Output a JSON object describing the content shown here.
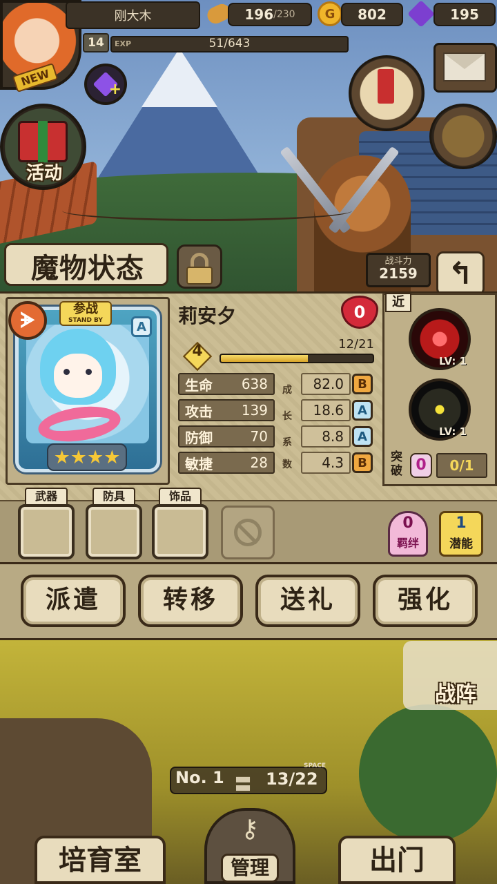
{
  "player": {
    "name": "刚大木",
    "level": "14",
    "exp_label": "EXP",
    "exp_value": "51/643",
    "exp_progress": 0.079,
    "new_tag": "NEW"
  },
  "resources": {
    "stamina": "196",
    "stamina_max": "/230",
    "gold": "802",
    "gems": "195"
  },
  "menu": {
    "event_label": "活动"
  },
  "header": {
    "title": "魔物状态",
    "power_label": "战斗力",
    "power_value": "2159",
    "back_icon": "↰"
  },
  "monster": {
    "rank_icon": "ᗘ",
    "standby_cn": "参战",
    "standby_en": "STAND BY",
    "card_grade": "A",
    "stars": "★★★★",
    "star_count": 4,
    "name": "莉安夕",
    "affection": "0",
    "level": "4",
    "level_progress": "12/21",
    "level_progress_ratio": 0.571,
    "growth_chars": [
      "成",
      "长",
      "系",
      "数"
    ],
    "stats": [
      {
        "name": "生命",
        "value": "638",
        "growth": "82.0",
        "grade": "B"
      },
      {
        "name": "攻击",
        "value": "139",
        "growth": "18.6",
        "grade": "A"
      },
      {
        "name": "防御",
        "value": "70",
        "growth": "8.8",
        "grade": "A"
      },
      {
        "name": "敏捷",
        "value": "28",
        "growth": "4.3",
        "grade": "B"
      }
    ]
  },
  "skills": {
    "range": "近",
    "items": [
      {
        "level": "LV: 1"
      },
      {
        "level": "LV: 1"
      }
    ],
    "breakthrough_label": "突破",
    "breakthrough_count": "0",
    "breakthrough_progress": "0/1"
  },
  "equipment": {
    "slots": [
      "武器",
      "防具",
      "饰品"
    ],
    "bond_count": "0",
    "bond_label": "羁绊",
    "potential_count": "1",
    "potential_label": "潜能"
  },
  "actions": [
    "派遣",
    "转移",
    "送礼",
    "强化"
  ],
  "field": {
    "battle_label": "战阵",
    "counter_no_label": "No. 1",
    "counter_space_label": "SPACE",
    "counter_eq": "〓",
    "counter_value": "13/22"
  },
  "bottom_nav": {
    "nursery": "培育室",
    "manage": "管理",
    "exit": "出门"
  },
  "colors": {
    "parchment": "#cbbd94",
    "dark_frame": "#3a2a18",
    "grade_A": "#bfe2f2",
    "grade_B": "#f0a840",
    "heart": "#d42a3a"
  }
}
